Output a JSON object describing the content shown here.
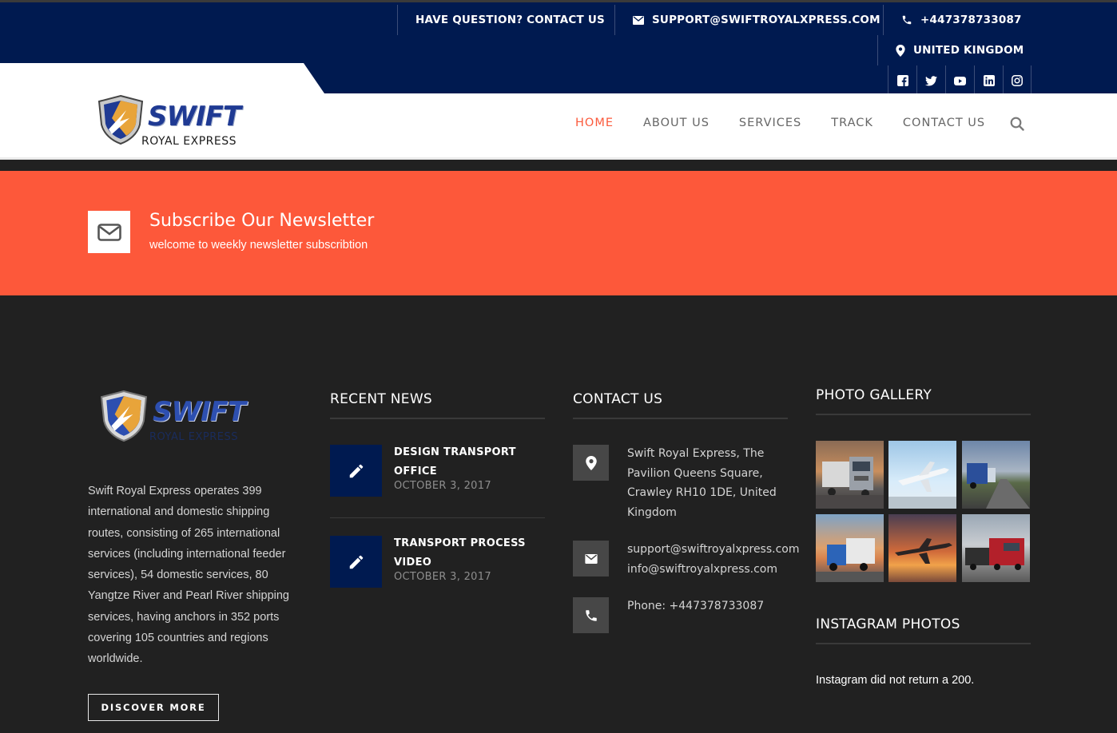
{
  "topbar": {
    "question": "HAVE QUESTION? CONTACT US",
    "email": "SUPPORT@SWIFTROYALXPRESS.COM",
    "phone": "+447378733087",
    "location": "UNITED KINGDOM",
    "socials": [
      "facebook-icon",
      "twitter-icon",
      "youtube-icon",
      "linkedin-icon",
      "instagram-icon"
    ]
  },
  "logo": {
    "title": "SWIFT",
    "subtitle": "ROYAL EXPRESS"
  },
  "nav": {
    "items": [
      "HOME",
      "ABOUT US",
      "SERVICES",
      "TRACK",
      "CONTACT US"
    ],
    "active": "HOME"
  },
  "newsletter": {
    "title": "Subscribe Our Newsletter",
    "subtitle": "welcome to weekly newsletter subscribtion"
  },
  "footer": {
    "about": "Swift Royal Express operates 399 international and domestic shipping routes, consisting of 265 international services (including international feeder services), 54 domestic services, 80 Yangtze River and Pearl River shipping services, having anchors in 352 ports covering 105 countries and regions worldwide.",
    "discover_label": "DISCOVER MORE",
    "recent_news_heading": "RECENT NEWS",
    "news": [
      {
        "title": "DESIGN TRANSPORT OFFICE",
        "date": "OCTOBER 3, 2017"
      },
      {
        "title": "TRANSPORT PROCESS VIDEO",
        "date": "OCTOBER 3, 2017"
      }
    ],
    "contact_heading": "CONTACT US",
    "contact": {
      "address": "Swift Royal Express, The Pavilion Queens Square, Crawley RH10 1DE, United Kingdom",
      "email_1": "support@swiftroyalxpress.com",
      "email_2": "info@swiftroyalxpress.com",
      "phone": "Phone: +447378733087"
    },
    "gallery_heading": "PHOTO GALLERY",
    "instagram_heading": "INSTAGRAM PHOTOS",
    "instagram_text": "Instagram did not return a 200."
  },
  "colors": {
    "navy": "#001a50",
    "accent": "#fd583a",
    "footer_bg": "#212121"
  }
}
